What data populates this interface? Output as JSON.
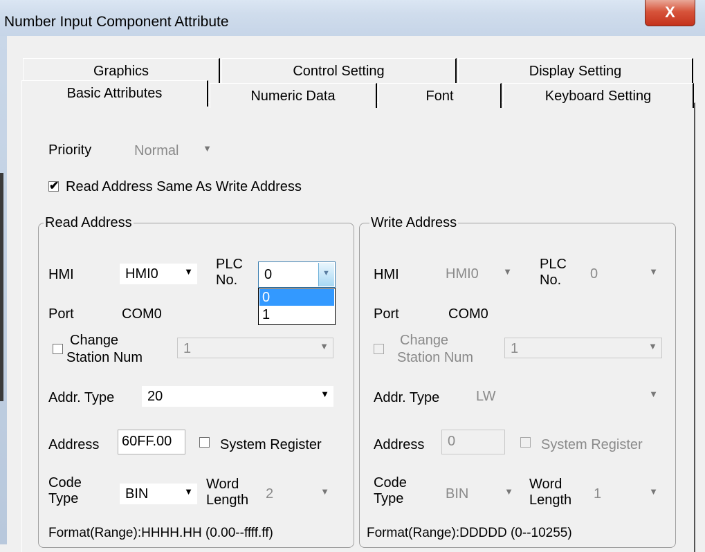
{
  "window": {
    "title": "Number Input Component Attribute",
    "close_label": "X"
  },
  "tabs_row1": [
    "Graphics",
    "Control Setting",
    "Display Setting"
  ],
  "tabs_row2": [
    "Basic Attributes",
    "Numeric Data",
    "Font",
    "Keyboard Setting"
  ],
  "priority": {
    "label": "Priority",
    "value": "Normal"
  },
  "same_address": {
    "label": "Read Address Same As Write Address",
    "checked": true
  },
  "read": {
    "title": "Read Address",
    "hmi_label": "HMI",
    "hmi_value": "HMI0",
    "plc_label_1": "PLC",
    "plc_label_2": "No.",
    "plc_value": "0",
    "plc_options": [
      "0",
      "1"
    ],
    "port_label": "Port",
    "port_value": "COM0",
    "change_label_1": "Change",
    "change_label_2": "Station Num",
    "change_value": "1",
    "addr_type_label": "Addr. Type",
    "addr_type_value": "20",
    "address_label": "Address",
    "address_value": "60FF.00",
    "sysreg_label": "System Register",
    "code_label_1": "Code",
    "code_label_2": "Type",
    "code_value": "BIN",
    "word_label_1": "Word",
    "word_label_2": "Length",
    "word_value": "2",
    "format": "Format(Range):HHHH.HH (0.00--ffff.ff)"
  },
  "write": {
    "title": "Write Address",
    "hmi_label": "HMI",
    "hmi_value": "HMI0",
    "plc_label_1": "PLC",
    "plc_label_2": "No.",
    "plc_value": "0",
    "port_label": "Port",
    "port_value": "COM0",
    "change_label_1": "Change",
    "change_label_2": "Station Num",
    "change_value": "1",
    "addr_type_label": "Addr. Type",
    "addr_type_value": "LW",
    "address_label": "Address",
    "address_value": "0",
    "sysreg_label": "System Register",
    "code_label_1": "Code",
    "code_label_2": "Type",
    "code_value": "BIN",
    "word_label_1": "Word",
    "word_label_2": "Length",
    "word_value": "1",
    "format": "Format(Range):DDDDD (0--10255)"
  },
  "icons": {
    "dropdown": "chevron-down-icon",
    "close": "close-icon",
    "check": "check-icon"
  }
}
